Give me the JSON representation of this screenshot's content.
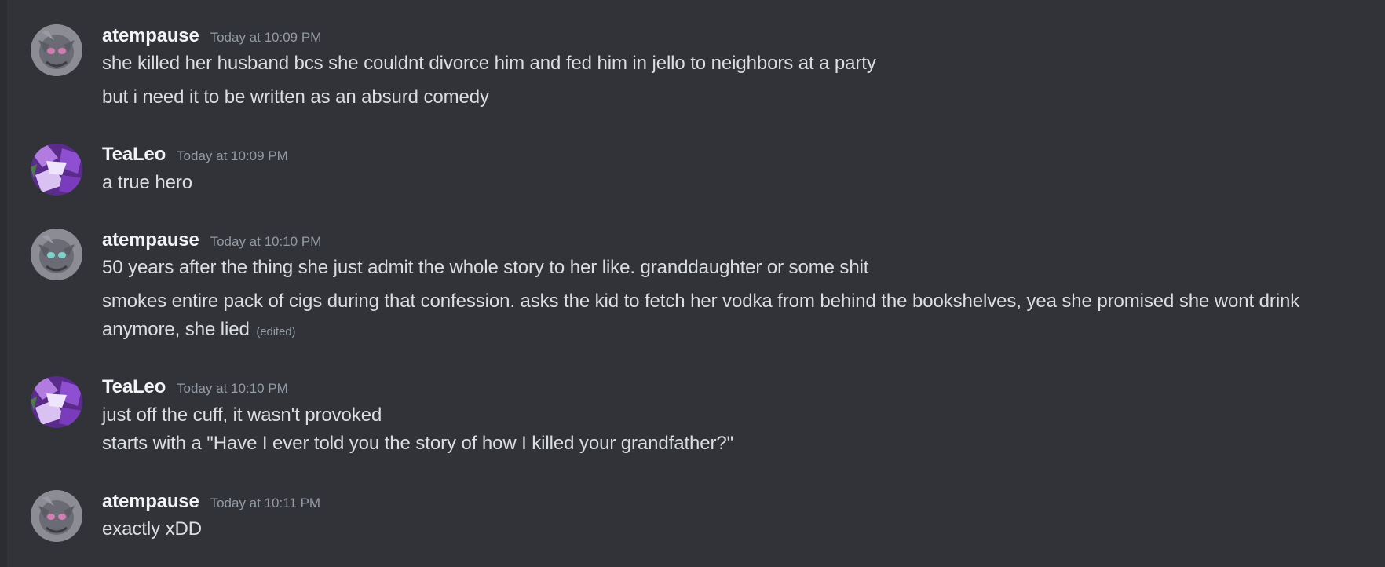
{
  "messages": [
    {
      "username": "atempause",
      "timestamp": "Today at 10:09 PM",
      "avatar": "gray-creature-avatar",
      "lines": [
        "she killed her husband bcs she couldnt divorce him and fed him in jello to neighbors at a party",
        "but i need it to be written as an absurd comedy"
      ]
    },
    {
      "username": "TeaLeo",
      "timestamp": "Today at 10:09 PM",
      "avatar": "purple-art-avatar",
      "lines": [
        "a true hero"
      ]
    },
    {
      "username": "atempause",
      "timestamp": "Today at 10:10 PM",
      "avatar": "gray-creature-avatar",
      "lines": [
        "50 years after the thing she just admit the whole story to her like. granddaughter or some shit",
        "smokes entire pack of cigs during that confession. asks the kid to fetch her vodka from behind the bookshelves, yea she promised she wont drink anymore, she lied"
      ],
      "edited_label": "(edited)"
    },
    {
      "username": "TeaLeo",
      "timestamp": "Today at 10:10 PM",
      "avatar": "purple-art-avatar",
      "lines": [
        "just off the cuff, it wasn't provoked",
        "starts with a \"Have I ever told you the story of how I killed your grandfather?\""
      ]
    },
    {
      "username": "atempause",
      "timestamp": "Today at 10:11 PM",
      "avatar": "gray-creature-avatar",
      "lines": [
        "exactly xDD"
      ]
    }
  ],
  "colors": {
    "background": "#313338",
    "username": "#f2f3f5",
    "text": "#dbdee1",
    "muted": "#949ba4"
  }
}
